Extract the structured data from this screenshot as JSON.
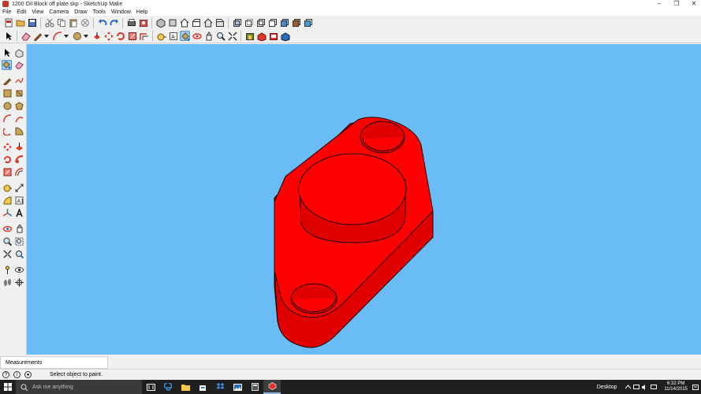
{
  "window": {
    "title": "1200 Oil Block off plate.skp - SketchUp Make"
  },
  "menu": [
    "File",
    "Edit",
    "View",
    "Camera",
    "Draw",
    "Tools",
    "Window",
    "Help"
  ],
  "toolbar1": [
    "open-folder",
    "save",
    "cut",
    "copy",
    "paste",
    "erase",
    "undo",
    "redo",
    "print",
    "model-info",
    "iso-view",
    "top-view",
    "front-view",
    "right-view",
    "back-view",
    "left-view",
    "xray",
    "back-edges",
    "wireframe",
    "hidden-line",
    "shaded",
    "textured",
    "monochrome"
  ],
  "toolbar2": [
    "select",
    "eraser",
    "line",
    "arc",
    "circle",
    "push-pull",
    "move",
    "rotate",
    "scale",
    "offset",
    "tape-measure",
    "text",
    "paint",
    "orbit",
    "pan",
    "zoom",
    "zoom-extents",
    "3d-warehouse",
    "extension-warehouse",
    "layout",
    "share-component"
  ],
  "measurements": {
    "label": "Measurements"
  },
  "status": {
    "text": "Select object to paint."
  },
  "taskbar": {
    "search_placeholder": "Ask me anything",
    "desktop_label": "Desktop",
    "time": "6:32 PM",
    "date": "11/14/2015"
  },
  "colors": {
    "viewport": "#69bcf5",
    "model_face": "#ff0000",
    "accent": "#9ec7ec"
  }
}
